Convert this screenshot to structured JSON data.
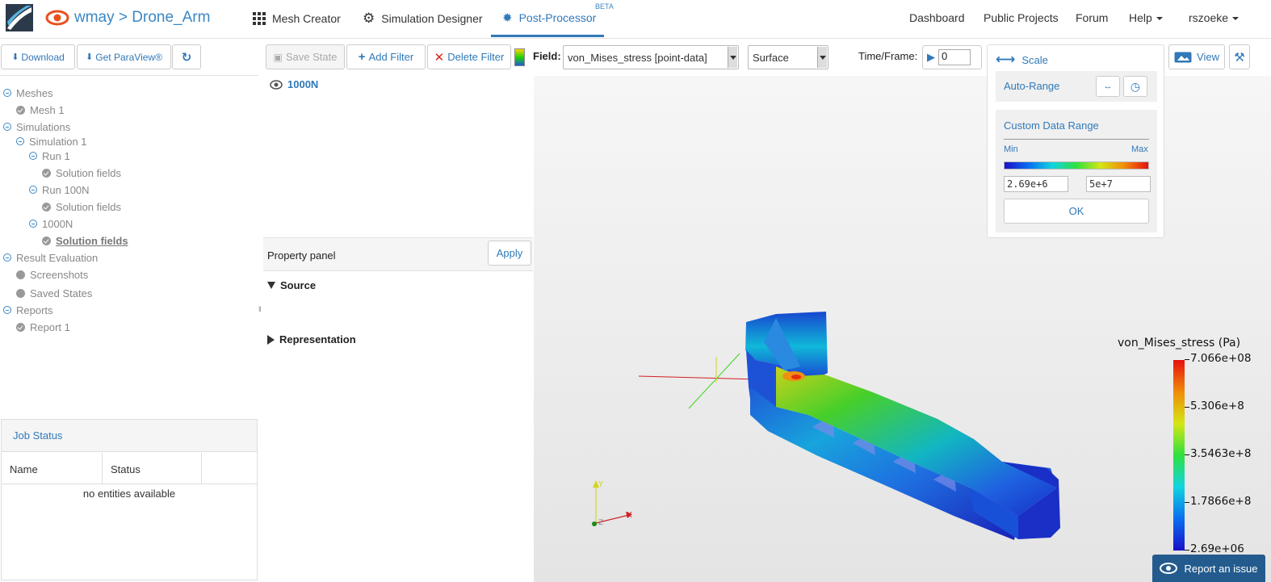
{
  "navbar": {
    "project_title": "wmay > Drone_Arm",
    "tabs": [
      {
        "label": "Mesh Creator"
      },
      {
        "label": "Simulation Designer"
      },
      {
        "label": "Post-Processor"
      }
    ],
    "beta_label": "BETA",
    "right_links": [
      {
        "label": "Dashboard"
      },
      {
        "label": "Public Projects"
      },
      {
        "label": "Forum"
      },
      {
        "label": "Help"
      },
      {
        "label": "rszoeke"
      }
    ]
  },
  "left_toolbar": {
    "download": "Download",
    "get_paraview": "Get ParaView®"
  },
  "tree": {
    "meshes": "Meshes",
    "mesh1": "Mesh 1",
    "simulations": "Simulations",
    "simulation1": "Simulation 1",
    "run1": "Run 1",
    "run1_fields": "Solution fields",
    "run100n": "Run 100N",
    "run100n_fields": "Solution fields",
    "run1000n": "1000N",
    "run1000n_fields": "Solution fields",
    "result_evaluation": "Result Evaluation",
    "screenshots": "Screenshots",
    "saved_states": "Saved States",
    "reports": "Reports",
    "report1": "Report 1"
  },
  "job_status": {
    "title": "Job Status",
    "columns": [
      "Name",
      "Status"
    ],
    "empty": "no entities available"
  },
  "middle": {
    "save_state": "Save State",
    "add_filter": "Add Filter",
    "delete_filter": "Delete Filter",
    "pipeline_item": "1000N",
    "property_panel": "Property panel",
    "apply": "Apply",
    "source": "Source",
    "representation": "Representation"
  },
  "controls": {
    "field_label": "Field:",
    "field_value": "von_Mises_stress [point-data]",
    "representation_value": "Surface",
    "time_label": "Time/Frame:",
    "time_value": "0"
  },
  "scale_panel": {
    "title": "Scale",
    "auto_range": "Auto-Range",
    "custom_range": "Custom Data Range",
    "min_label": "Min",
    "max_label": "Max",
    "min_value": "2.69e+6",
    "max_value": "5e+7",
    "ok": "OK"
  },
  "view_button": "View",
  "legend": {
    "title": "von_Mises_stress (Pa)",
    "ticks": [
      "7.066e+08",
      "5.306e+8",
      "3.5463e+8",
      "1.7866e+8",
      "2.69e+06"
    ]
  },
  "axes": {
    "x": "X",
    "y": "Y",
    "z": "Z"
  },
  "report_issue": "Report an issue",
  "colors": {
    "accent": "#3179b8",
    "report_button": "#235b8e"
  }
}
